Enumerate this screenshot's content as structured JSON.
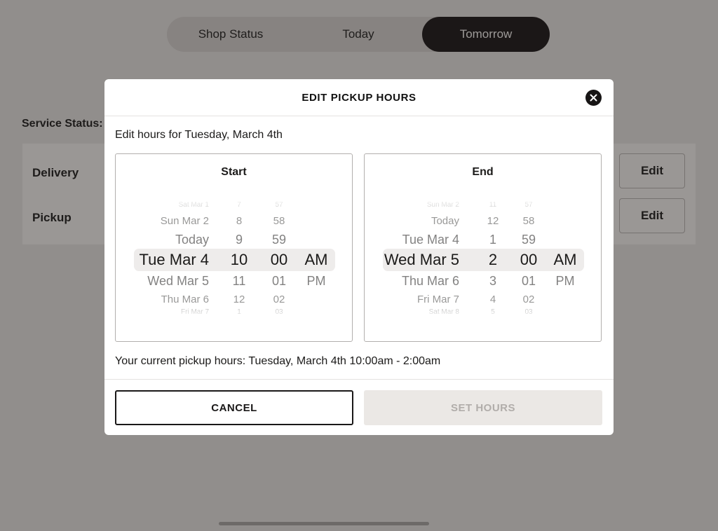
{
  "tabs": [
    {
      "label": "Shop Status",
      "active": false
    },
    {
      "label": "Today",
      "active": false
    },
    {
      "label": "Tomorrow",
      "active": true
    }
  ],
  "service": {
    "label": "Service Status:",
    "rows": [
      {
        "label": "Delivery",
        "edit_label": "Edit"
      },
      {
        "label": "Pickup",
        "edit_label": "Edit"
      }
    ]
  },
  "modal": {
    "title": "EDIT PICKUP HOURS",
    "edit_for": "Edit hours for Tuesday, March 4th",
    "start": {
      "title": "Start",
      "days": [
        "Sat Mar 1",
        "Sun Mar 2",
        "Today",
        "Tue Mar 4",
        "Wed Mar 5",
        "Thu Mar 6",
        "Fri Mar 7"
      ],
      "hours": [
        "7",
        "8",
        "9",
        "10",
        "11",
        "12",
        "1"
      ],
      "minutes": [
        "57",
        "58",
        "59",
        "00",
        "01",
        "02",
        "03"
      ],
      "ampm": [
        "",
        "",
        "",
        "AM",
        "PM",
        "",
        ""
      ]
    },
    "end": {
      "title": "End",
      "days": [
        "Sun Mar 2",
        "Today",
        "Tue Mar 4",
        "Wed Mar 5",
        "Thu Mar 6",
        "Fri Mar 7",
        "Sat Mar 8"
      ],
      "hours": [
        "11",
        "12",
        "1",
        "2",
        "3",
        "4",
        "5"
      ],
      "minutes": [
        "57",
        "58",
        "59",
        "00",
        "01",
        "02",
        "03"
      ],
      "ampm": [
        "",
        "",
        "",
        "AM",
        "PM",
        "",
        ""
      ]
    },
    "current_hours": "Your current pickup hours: Tuesday, March 4th 10:00am - 2:00am",
    "cancel_label": "CANCEL",
    "set_label": "SET HOURS"
  },
  "colors": {
    "accent": "#1b1717",
    "overlay": "#918e8c",
    "selected_band": "#eeeceb",
    "disabled_button": "#ebe8e5"
  }
}
